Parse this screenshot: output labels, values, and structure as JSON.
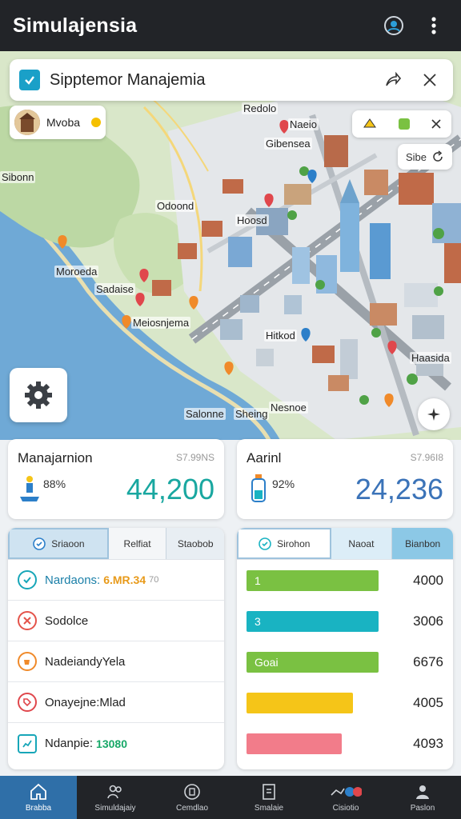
{
  "app": {
    "title": "Simulajensia"
  },
  "search": {
    "text": "Sipptemor Manajemia"
  },
  "place_chip": {
    "label": "Mvoba"
  },
  "mini_badge": {
    "label": "Sibe"
  },
  "map_labels": [
    "Redolo",
    "Naeio",
    "Gibensea",
    "Odoond",
    "Hoosd",
    "Moroeda",
    "Sadaise",
    "Meiosnjema",
    "Hitkod",
    "Haasida",
    "Salonne",
    "Sibonn",
    "Sheing",
    "Nesnoe"
  ],
  "stats": [
    {
      "title": "Manajarnion",
      "meta": "S7.99NS",
      "pct": "88%",
      "value": "44,200",
      "color": "#19a7a0"
    },
    {
      "title": "Aarinl",
      "meta": "S7.96I8",
      "pct": "92%",
      "value": "24,236",
      "color": "#3b73b8"
    }
  ],
  "left_panel": {
    "tabs": [
      "Sriaoon",
      "Relfiat",
      "Staobob"
    ],
    "rows": [
      {
        "label": "Nardaons:",
        "extra": "6.MR.34",
        "extra_suffix": "70",
        "icon": "check-icon",
        "color": "#17a6b8",
        "extra_color": "#e89a1a"
      },
      {
        "label": "Sodolce",
        "extra": "",
        "extra_suffix": "",
        "icon": "tools-icon",
        "color": "#e4534a",
        "extra_color": ""
      },
      {
        "label": "NadeiandyYela",
        "extra": "",
        "extra_suffix": "",
        "icon": "cup-icon",
        "color": "#f08a2a",
        "extra_color": ""
      },
      {
        "label": "Onayejne:Mlad",
        "extra": "",
        "extra_suffix": "",
        "icon": "tag-icon",
        "color": "#e0474c",
        "extra_color": ""
      },
      {
        "label": "Ndanpie:",
        "extra": "13080",
        "extra_suffix": "",
        "icon": "chart-icon",
        "color": "#17a6b8",
        "extra_color": "#18a868"
      }
    ]
  },
  "right_panel": {
    "tabs": [
      "Sirohon",
      "Naoat",
      "Bianbon"
    ],
    "bars": [
      {
        "label": "1",
        "fraction": 0.97,
        "color": "#7ac142",
        "value": "4000"
      },
      {
        "label": "3",
        "fraction": 0.97,
        "color": "#19b3c2",
        "value": "3006"
      },
      {
        "label": "Goai",
        "fraction": 0.97,
        "color": "#7ac142",
        "value": "6676"
      },
      {
        "label": "",
        "fraction": 0.78,
        "color": "#f5c518",
        "value": "4005"
      },
      {
        "label": "",
        "fraction": 0.7,
        "color": "#f27c8a",
        "value": "4093"
      }
    ]
  },
  "nav": [
    {
      "label": "Brabba",
      "icon": "home-icon"
    },
    {
      "label": "Simuldajaiy",
      "icon": "people-icon"
    },
    {
      "label": "Cemdlao",
      "icon": "badge-icon"
    },
    {
      "label": "Smalaie",
      "icon": "document-icon"
    },
    {
      "label": "Cisiotio",
      "icon": "hand-icon"
    },
    {
      "label": "Paslon",
      "icon": "person-icon"
    }
  ]
}
